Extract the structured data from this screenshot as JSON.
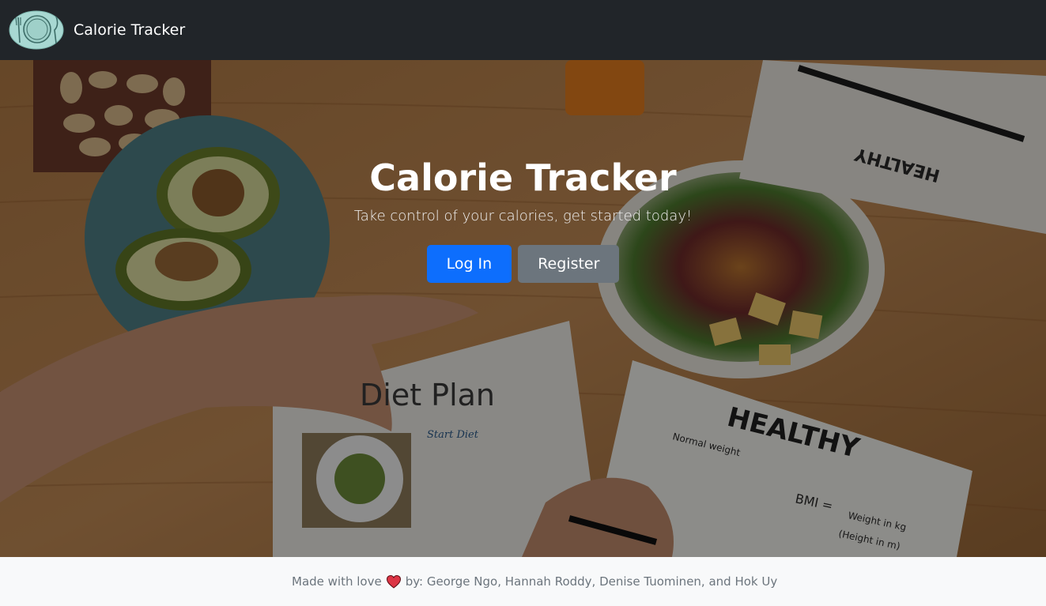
{
  "navbar": {
    "brand_name": "Calorie Tracker",
    "logo_icon": "plate-fork-knife-logo"
  },
  "hero": {
    "title": "Calorie Tracker",
    "subtitle": "Take control of your calories, get started today!",
    "login_label": "Log In",
    "register_label": "Register",
    "background_texts": {
      "notebook_title": "Diet Plan",
      "notebook_start": "Start Diet",
      "chart_title": "HEALTHY",
      "chart_normal": "Normal weight",
      "bmi_label": "BMI =",
      "bmi_formula_top": "Weight in kg",
      "bmi_formula_bottom": "(Height in m)",
      "top_paper_title": "HEALTHY"
    }
  },
  "footer": {
    "prefix": "Made with love",
    "suffix": "by: George Ngo, Hannah Roddy, Denise Tuominen, and Hok Uy",
    "heart_icon": "heart-icon"
  },
  "colors": {
    "navbar_bg": "#212529",
    "primary": "#0d6efd",
    "secondary": "#6c757d",
    "footer_bg": "#f8f9fa",
    "heart": "#dc3545"
  }
}
